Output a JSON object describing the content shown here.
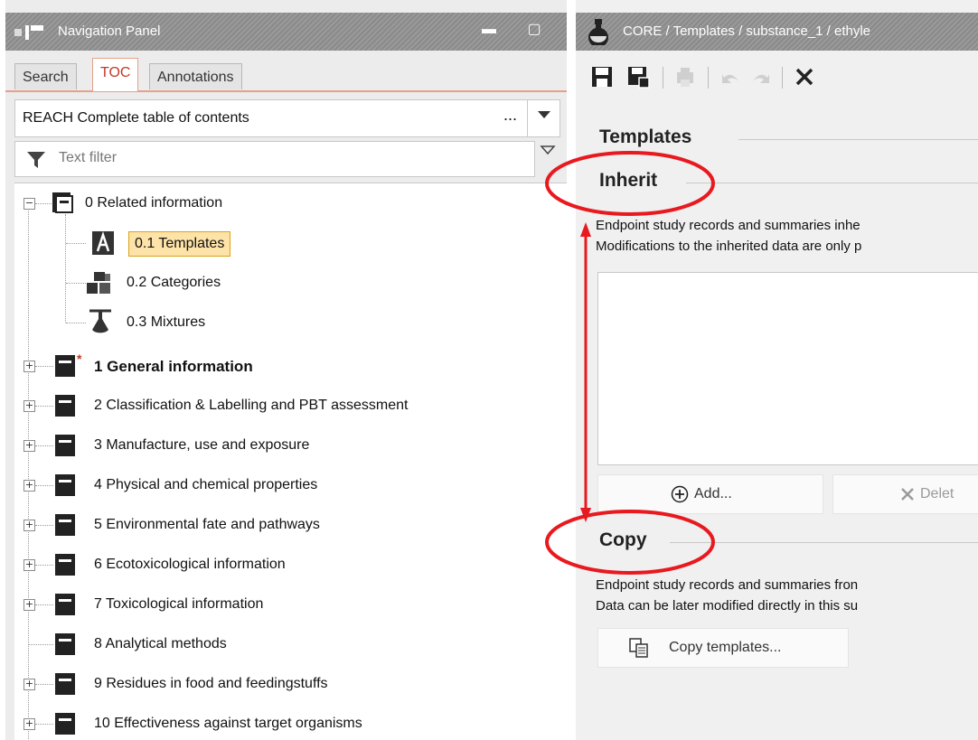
{
  "nav_panel": {
    "title": "Navigation Panel",
    "tabs": [
      {
        "label": "Search",
        "active": false
      },
      {
        "label": "TOC",
        "active": true
      },
      {
        "label": "Annotations",
        "active": false
      }
    ],
    "toc_select": {
      "value": "REACH Complete table of contents",
      "more": "..."
    },
    "filter": {
      "placeholder": "Text filter"
    },
    "tree": [
      {
        "label": "0 Related information",
        "level": 0,
        "expanded": true
      },
      {
        "label": "0.1 Templates",
        "level": 1,
        "selected": true
      },
      {
        "label": "0.2 Categories",
        "level": 1
      },
      {
        "label": "0.3 Mixtures",
        "level": 1
      },
      {
        "label": "1 General information",
        "level": 0,
        "bold": true,
        "required": true
      },
      {
        "label": "2 Classification & Labelling and PBT assessment",
        "level": 0
      },
      {
        "label": "3 Manufacture, use and exposure",
        "level": 0
      },
      {
        "label": "4 Physical and chemical properties",
        "level": 0
      },
      {
        "label": "5 Environmental fate and pathways",
        "level": 0
      },
      {
        "label": "6 Ecotoxicological information",
        "level": 0
      },
      {
        "label": "7 Toxicological information",
        "level": 0
      },
      {
        "label": "8 Analytical methods",
        "level": 0,
        "no_toggle": true
      },
      {
        "label": "9 Residues in food and feedingstuffs",
        "level": 0
      },
      {
        "label": "10 Effectiveness against target organisms",
        "level": 0
      }
    ]
  },
  "editor": {
    "title": "CORE / Templates / substance_1 / ethyle",
    "sections": {
      "templates": "Templates",
      "inherit": {
        "title": "Inherit",
        "desc_line1": "Endpoint study records and summaries inhe",
        "desc_line2": "Modifications to the inherited data are only p",
        "add_label": "Add...",
        "delete_label": "Delet"
      },
      "copy": {
        "title": "Copy",
        "desc_line1": "Endpoint study records and summaries fron",
        "desc_line2": "Data can be later modified directly in this su",
        "copy_button": "Copy templates..."
      }
    }
  },
  "colors": {
    "annotation": "#e8191f",
    "selected_bg": "#fde3a7",
    "active_tab": "#c0392b"
  }
}
